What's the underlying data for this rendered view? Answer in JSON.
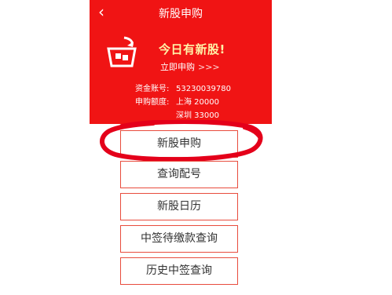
{
  "header": {
    "back_icon": "chevron-left-icon",
    "back_glyph": "‹",
    "title": "新股申购",
    "background": "#f01414"
  },
  "promo": {
    "icon": "basket-icon",
    "heading": "今日有新股!",
    "link_label": "立即申购",
    "link_arrows": ">>>"
  },
  "account": {
    "account_label": "资金账号:",
    "account_value": "53230039780",
    "quota_label": "申购额度:",
    "quota_sh": "上海 20000",
    "quota_sz": "深圳 33000"
  },
  "menu": {
    "items": [
      {
        "label": "新股申购"
      },
      {
        "label": "查询配号"
      },
      {
        "label": "新股日历"
      },
      {
        "label": "中签待缴款查询"
      },
      {
        "label": "历史中签查询"
      }
    ],
    "border_color": "#e84c3d"
  },
  "annotation": {
    "ring_color": "#e4001a"
  }
}
